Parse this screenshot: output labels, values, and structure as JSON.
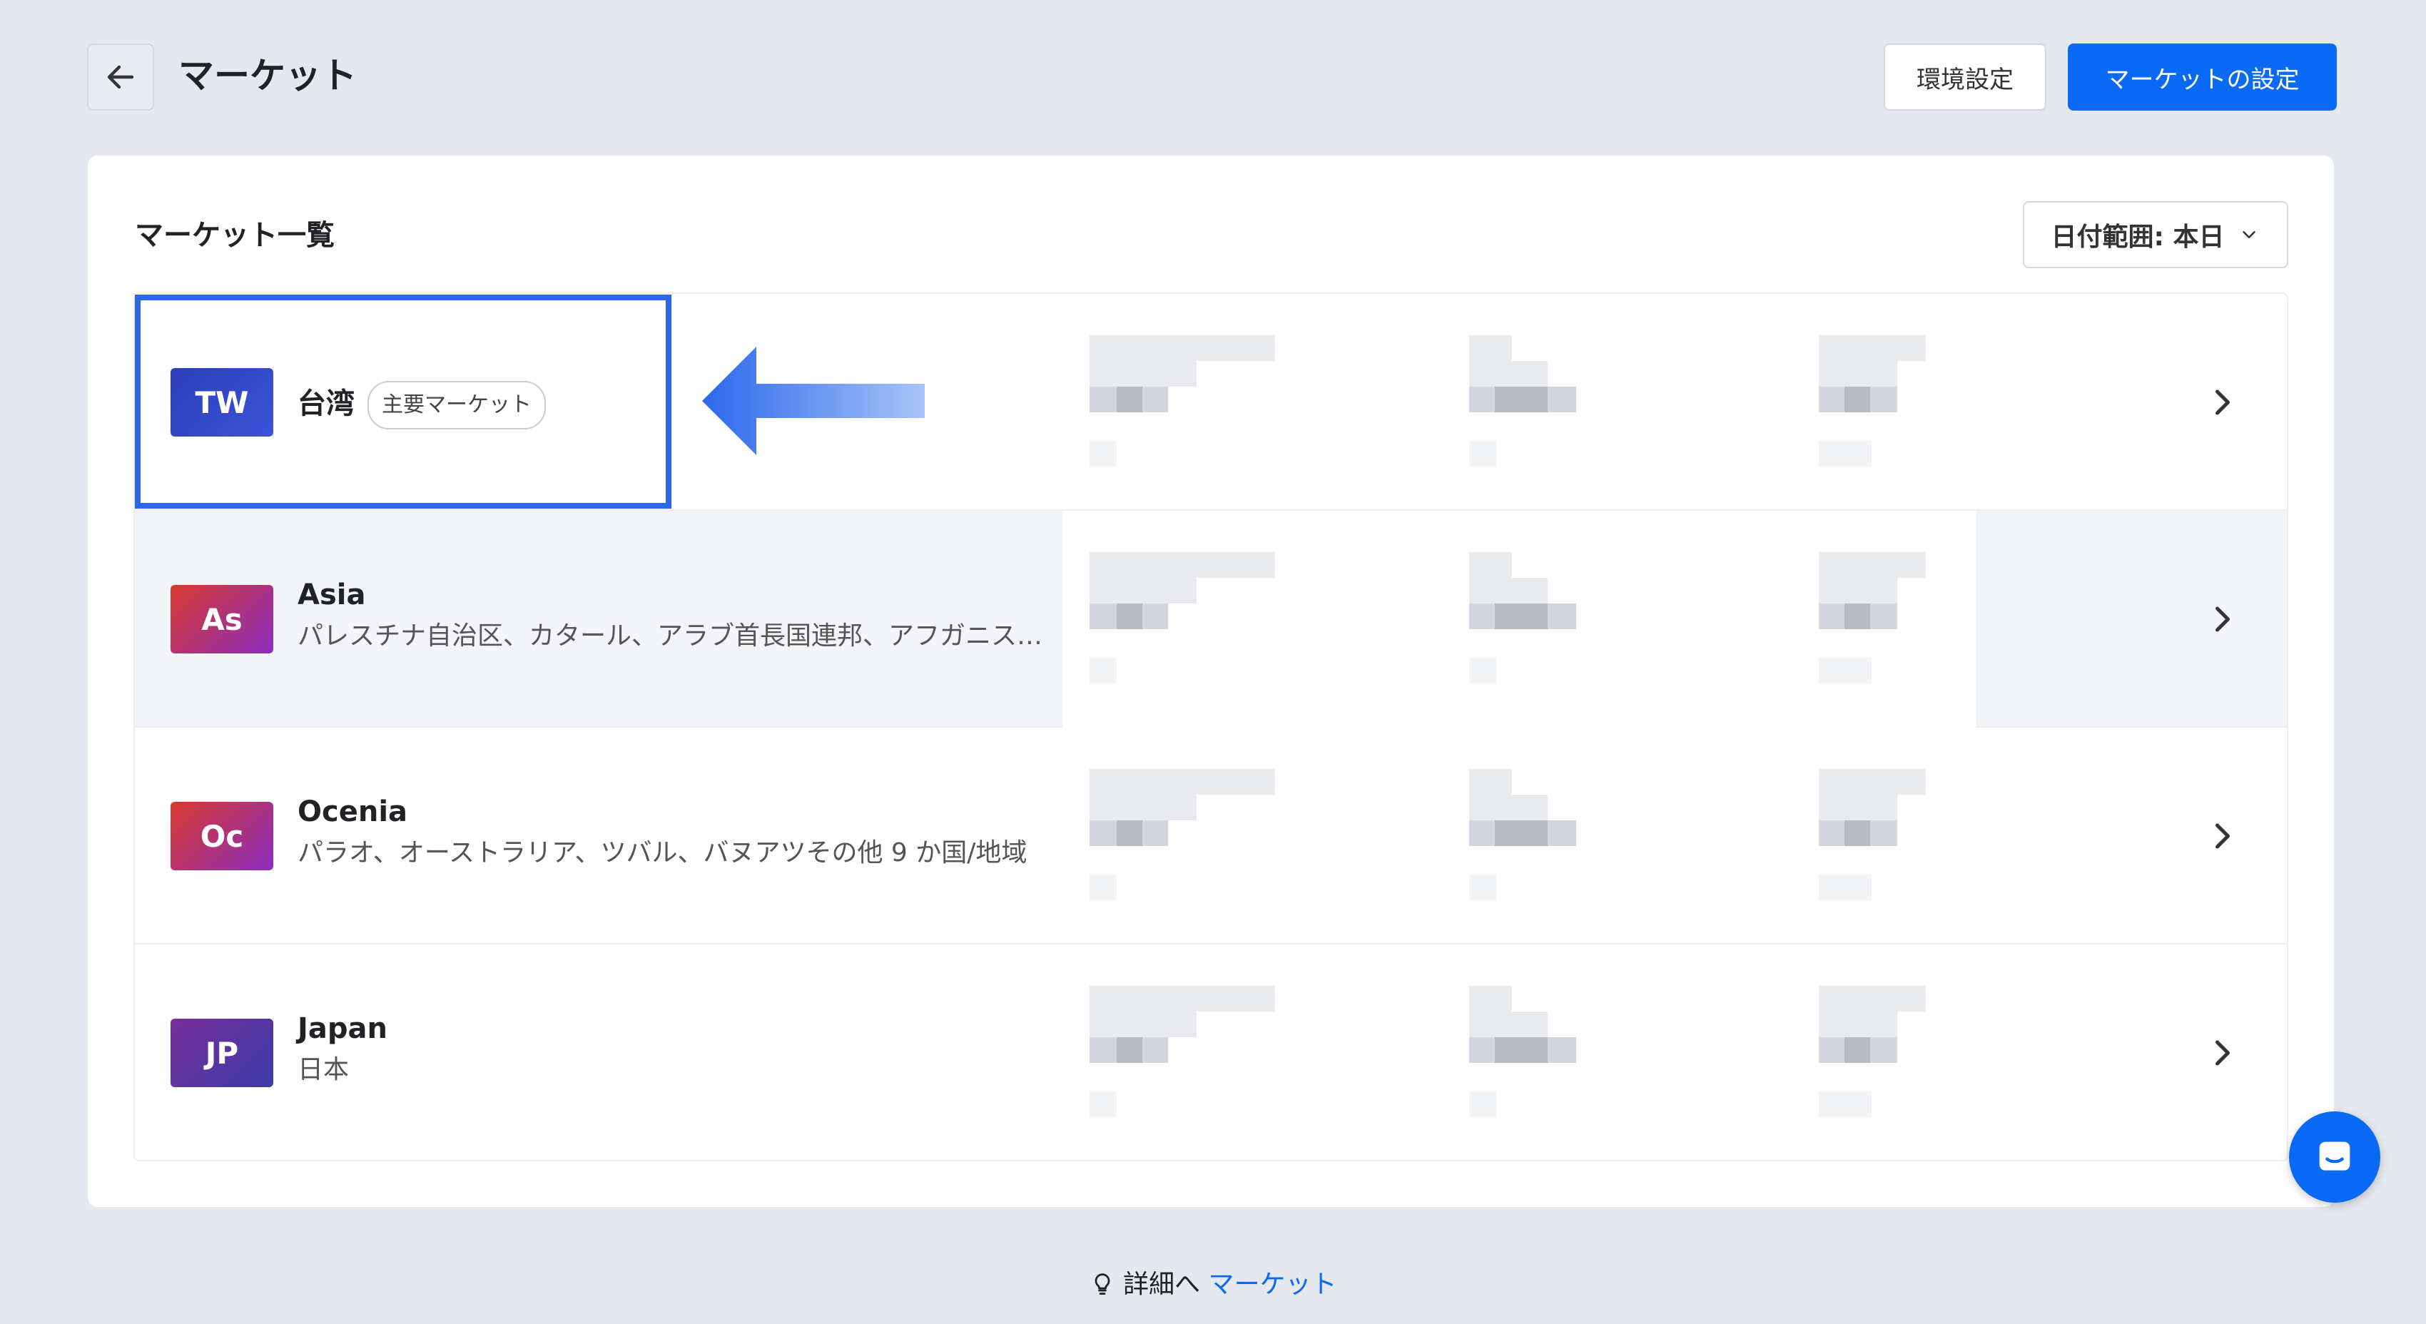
{
  "header": {
    "title": "マーケット",
    "preferences_label": "環境設定",
    "market_settings_label": "マーケットの設定"
  },
  "card": {
    "title": "マーケット一覧",
    "date_range_label": "日付範囲: 本日"
  },
  "markets": [
    {
      "code": "TW",
      "name": "台湾",
      "tag": "主要マーケット",
      "countries": "",
      "badge_from": "#2a3fb8",
      "badge_to": "#3d53d8"
    },
    {
      "code": "As",
      "name": "Asia",
      "tag": "",
      "countries": "パレスチナ自治区、カタール、アラブ首長国連邦、アフガニス…",
      "badge_from": "#d8392c",
      "badge_to": "#8a2ec0"
    },
    {
      "code": "Oc",
      "name": "Ocenia",
      "tag": "",
      "countries": "パラオ、オーストラリア、ツバル、バヌアツその他 9 か国/地域",
      "badge_from": "#d8392c",
      "badge_to": "#8a2ec0"
    },
    {
      "code": "JP",
      "name": "Japan",
      "tag": "",
      "countries": "日本",
      "badge_from": "#7a2e9a",
      "badge_to": "#3a3ca8"
    }
  ],
  "footer": {
    "prefix": "詳細へ",
    "link_label": "マーケット"
  },
  "colors": {
    "primary": "#0a6af6",
    "highlight_box": "#2b68ec",
    "background": "#e5e8ee"
  },
  "icons": {
    "back": "arrow-left-icon",
    "chevron": "chevron-right-icon",
    "dropdown": "chevron-down-icon",
    "chat": "chat-icon",
    "lightbulb": "lightbulb-icon"
  }
}
